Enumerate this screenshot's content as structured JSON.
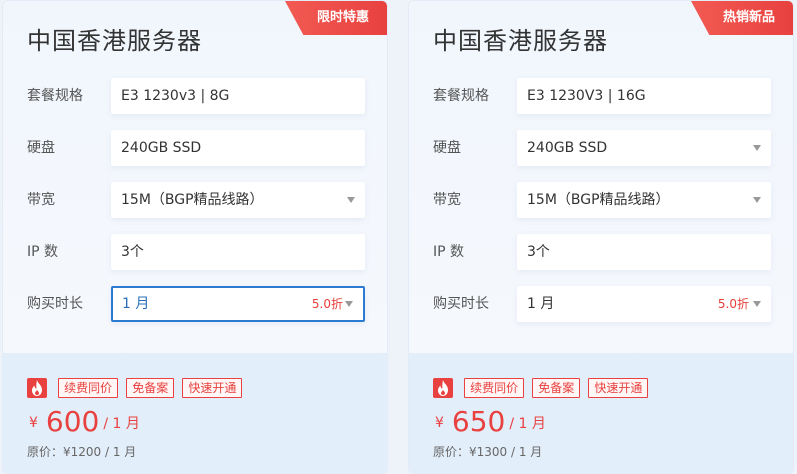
{
  "cards": [
    {
      "badge": "限时特惠",
      "title": "中国香港服务器",
      "rows": [
        {
          "label": "套餐规格",
          "value": "E3 1230v3 | 8G"
        },
        {
          "label": "硬盘",
          "value": "240GB SSD"
        },
        {
          "label": "带宽",
          "value": "15M（BGP精品线路）"
        },
        {
          "label": "IP 数",
          "value": "3个"
        },
        {
          "label": "购买时长",
          "value": "1 月",
          "discount": "5.0折"
        }
      ],
      "tags": [
        "续费同价",
        "免备案",
        "快速开通"
      ],
      "price": {
        "currency": "¥",
        "amount": "600",
        "unit": "/ 1 月"
      },
      "original_price": "原价：¥1200 / 1 月"
    },
    {
      "badge": "热销新品",
      "title": "中国香港服务器",
      "rows": [
        {
          "label": "套餐规格",
          "value": "E3 1230V3 | 16G"
        },
        {
          "label": "硬盘",
          "value": "240GB SSD"
        },
        {
          "label": "带宽",
          "value": "15M（BGP精品线路）"
        },
        {
          "label": "IP 数",
          "value": "3个"
        },
        {
          "label": "购买时长",
          "value": "1 月",
          "discount": "5.0折"
        }
      ],
      "tags": [
        "续费同价",
        "免备案",
        "快速开通"
      ],
      "price": {
        "currency": "¥",
        "amount": "650",
        "unit": "/ 1 月"
      },
      "original_price": "原价：¥1300 / 1 月"
    }
  ],
  "colors": {
    "accent_red": "#e8413f",
    "focus_blue": "#2a7bd1"
  },
  "icons": {
    "tag_icon": "fire-icon",
    "dropdown": "chevron-down-icon"
  }
}
